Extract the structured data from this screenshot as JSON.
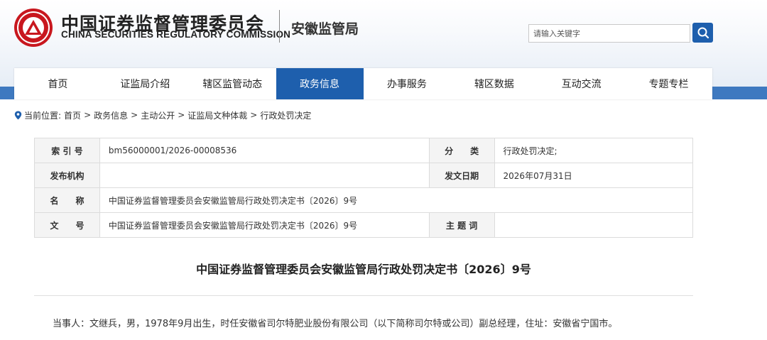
{
  "header": {
    "org_name_cn": "中国证券监督管理委员会",
    "org_name_en": "CHINA SECURITIES REGULATORY COMMISSION",
    "bureau": "安徽监管局",
    "search": {
      "placeholder": "请输入关键字"
    }
  },
  "nav": {
    "items": [
      {
        "label": "首页"
      },
      {
        "label": "证监局介绍"
      },
      {
        "label": "辖区监管动态"
      },
      {
        "label": "政务信息",
        "active": true
      },
      {
        "label": "办事服务"
      },
      {
        "label": "辖区数据"
      },
      {
        "label": "互动交流"
      },
      {
        "label": "专题专栏"
      }
    ]
  },
  "breadcrumb": {
    "prefix": "当前位置:",
    "items": [
      "首页",
      "政务信息",
      "主动公开",
      "证监局文种体裁",
      "行政处罚决定"
    ],
    "separator": ">"
  },
  "meta": {
    "index_label": "索 引 号",
    "index_value": "bm56000001/2026-00008536",
    "category_label": "分　　类",
    "category_value": "行政处罚决定;",
    "publisher_label": "发布机构",
    "publisher_value": "",
    "date_label": "发文日期",
    "date_value": "2026年07月31日",
    "name_label": "名　　称",
    "name_value": "中国证券监督管理委员会安徽监管局行政处罚决定书〔2026〕9号",
    "doc_no_label": "文　　号",
    "doc_no_value": "中国证券监督管理委员会安徽监管局行政处罚决定书〔2026〕9号",
    "subject_label": "主 题 词",
    "subject_value": ""
  },
  "document": {
    "title": "中国证券监督管理委员会安徽监管局行政处罚决定书〔2026〕9号",
    "paragraph_1": "当事人：文继兵，男，1978年9月出生，时任安徽省司尔特肥业股份有限公司（以下简称司尔特或公司）副总经理，住址：安徽省宁国市。"
  },
  "colors": {
    "primary_blue": "#1e5fad",
    "band_blue": "#3e79c0",
    "logo_red": "#c8171e"
  },
  "icons": {
    "logo": "csrc-emblem-icon",
    "search": "search-icon",
    "location": "location-pin-icon"
  }
}
